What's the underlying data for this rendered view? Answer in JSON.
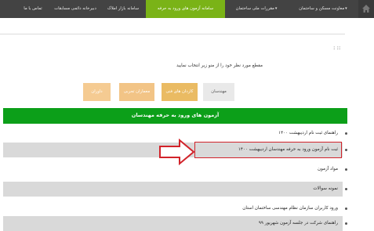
{
  "nav": {
    "items": [
      {
        "label": "معاونت مسکن و ساختمان",
        "caret": "▾",
        "active": false
      },
      {
        "label": "مقررات ملی ساختمان",
        "caret": "▾",
        "active": false
      },
      {
        "label": "سامانه آزمون های ورود به حرفه",
        "caret": "",
        "active": true
      },
      {
        "label": "سامانه بازار املاک",
        "caret": "",
        "active": false
      },
      {
        "label": "دبیرخانه دائمی مسابقات",
        "caret": "",
        "active": false
      },
      {
        "label": "تماس با ما",
        "caret": "",
        "active": false
      }
    ],
    "home_icon": "home-icon"
  },
  "page": {
    "dots": ": ::",
    "intro": "مقطع مورد نظر خود را از منو زیر انتخاب نمایید",
    "tabs": [
      "مهندسان",
      "کاردان های فنی",
      "معماران تجربی",
      "داوران"
    ]
  },
  "section": {
    "title": "آزمون های ورود به حرفه مهندسان",
    "items": [
      "راهنمای ثبت نام اردیبهشت ۱۴۰۰",
      "ثبت نام آزمون ورود به حرفه مهندسان اردیبهشت ۱۴۰۰",
      "مواد آزمون",
      "نمونه سوالات",
      "ورود کاربران سازمان نظام مهندسی ساختمان استان",
      "راهنمای شرکت در جلسه آزمون شهریور ۹۹"
    ]
  },
  "colors": {
    "accent_green": "#0c9f19",
    "nav_active": "#7ab317",
    "highlight_red": "#d2232a"
  }
}
